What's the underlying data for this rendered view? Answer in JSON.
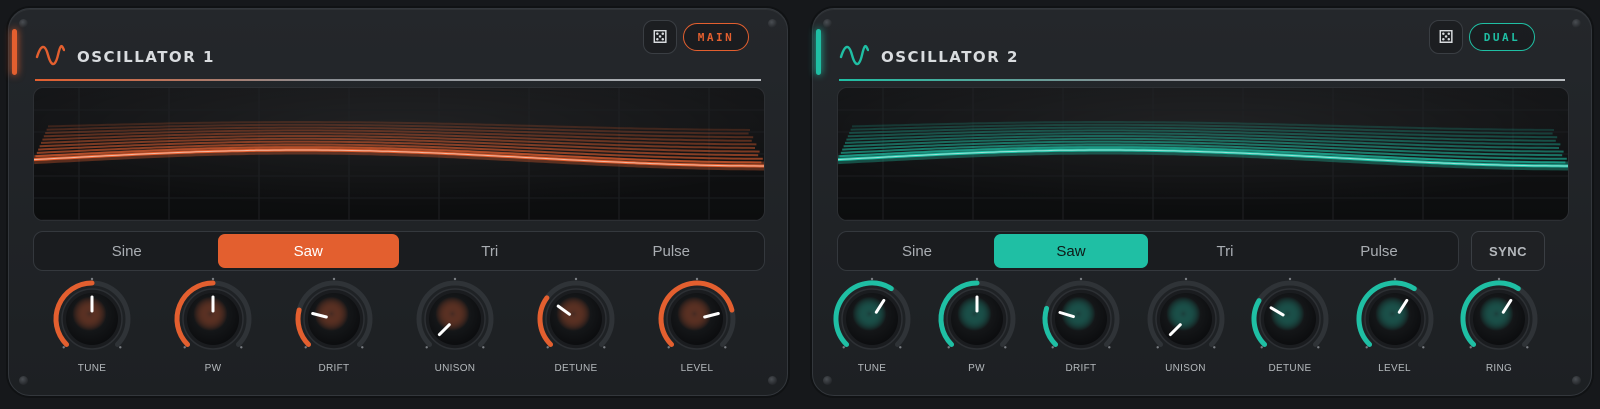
{
  "oscillators": [
    {
      "title": "OSCILLATOR 1",
      "badge": "MAIN",
      "dice_icon": "⚄",
      "accent": "#e35f2f",
      "icon": "sine-wave-icon",
      "waveforms": [
        "Sine",
        "Saw",
        "Tri",
        "Pulse"
      ],
      "active_waveform": "Saw",
      "knobs": [
        {
          "label": "TUNE",
          "value": 0.5
        },
        {
          "label": "PW",
          "value": 0.5
        },
        {
          "label": "DRIFT",
          "value": 0.22
        },
        {
          "label": "UNISON",
          "value": 0.0
        },
        {
          "label": "DETUNE",
          "value": 0.3
        },
        {
          "label": "LEVEL",
          "value": 0.78
        }
      ]
    },
    {
      "title": "OSCILLATOR 2",
      "badge": "DUAL",
      "dice_icon": "⚄",
      "accent": "#1fbfa4",
      "icon": "sine-wave-icon",
      "waveforms": [
        "Sine",
        "Saw",
        "Tri",
        "Pulse"
      ],
      "active_waveform": "Saw",
      "sync_label": "SYNC",
      "knobs": [
        {
          "label": "TUNE",
          "value": 0.62
        },
        {
          "label": "PW",
          "value": 0.5
        },
        {
          "label": "DRIFT",
          "value": 0.23
        },
        {
          "label": "UNISON",
          "value": 0.0
        },
        {
          "label": "DETUNE",
          "value": 0.28
        },
        {
          "label": "LEVEL",
          "value": 0.62
        },
        {
          "label": "RING",
          "value": 0.62
        }
      ]
    }
  ]
}
